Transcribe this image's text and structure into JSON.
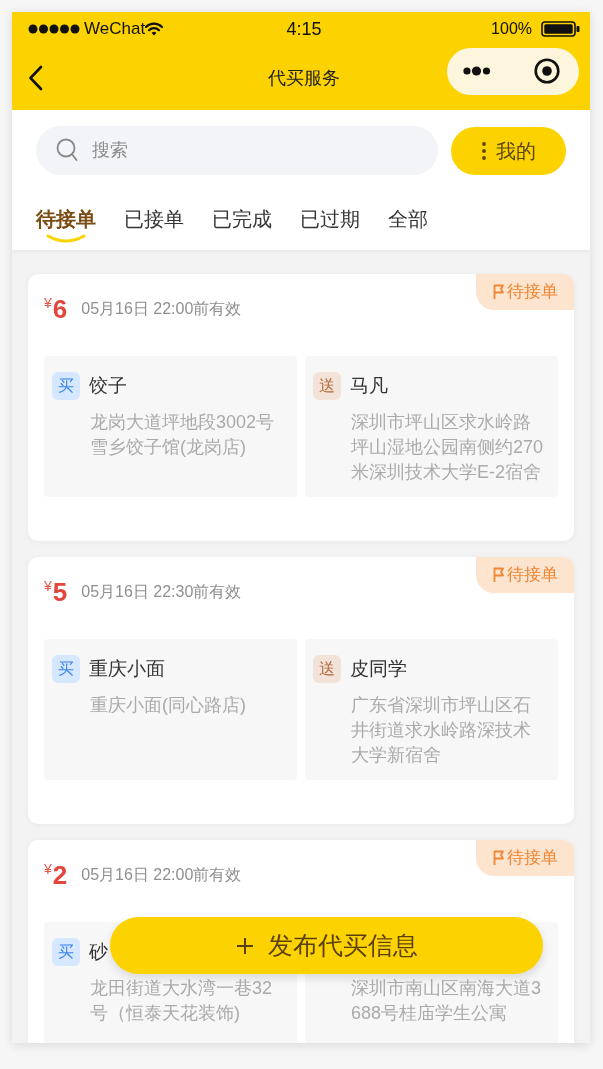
{
  "status_bar": {
    "carrier": "WeChat",
    "time": "4:15",
    "battery": "100%"
  },
  "nav_bar": {
    "title": "代买服务"
  },
  "search": {
    "placeholder": "搜索"
  },
  "mine_button": {
    "label": "我的"
  },
  "tabs": [
    {
      "label": "待接单",
      "selected": true
    },
    {
      "label": "已接单",
      "selected": false
    },
    {
      "label": "已完成",
      "selected": false
    },
    {
      "label": "已过期",
      "selected": false
    },
    {
      "label": "全部",
      "selected": false
    }
  ],
  "orders": [
    {
      "currency": "¥",
      "price": "6",
      "deadline": "05月16日 22:00前有效",
      "status": "待接单",
      "stops": [
        {
          "kind": "buy",
          "tag": "买",
          "name": "饺子",
          "address": "龙岗大道坪地段3002号雪乡饺子馆(龙岗店)"
        },
        {
          "kind": "deliver",
          "tag": "送",
          "name": "马凡",
          "address": "深圳市坪山区求水岭路坪山湿地公园南侧约270米深圳技术大学E-2宿舍"
        }
      ]
    },
    {
      "currency": "¥",
      "price": "5",
      "deadline": "05月16日 22:30前有效",
      "status": "待接单",
      "stops": [
        {
          "kind": "buy",
          "tag": "买",
          "name": "重庆小面",
          "address": "重庆小面(同心路店)"
        },
        {
          "kind": "deliver",
          "tag": "送",
          "name": "皮同学",
          "address": "广东省深圳市坪山区石井街道求水岭路深技术大学新宿舍"
        }
      ]
    },
    {
      "currency": "¥",
      "price": "2",
      "deadline": "05月16日 22:00前有效",
      "status": "待接单",
      "stops": [
        {
          "kind": "buy",
          "tag": "买",
          "name": "砂",
          "address": "龙田街道大水湾一巷32号（恒泰天花装饰)"
        },
        {
          "kind": "deliver",
          "address": "深圳市南山区南海大道3688号桂庙学生公寓"
        }
      ]
    }
  ],
  "publish_button": {
    "label": "发布代买信息"
  }
}
